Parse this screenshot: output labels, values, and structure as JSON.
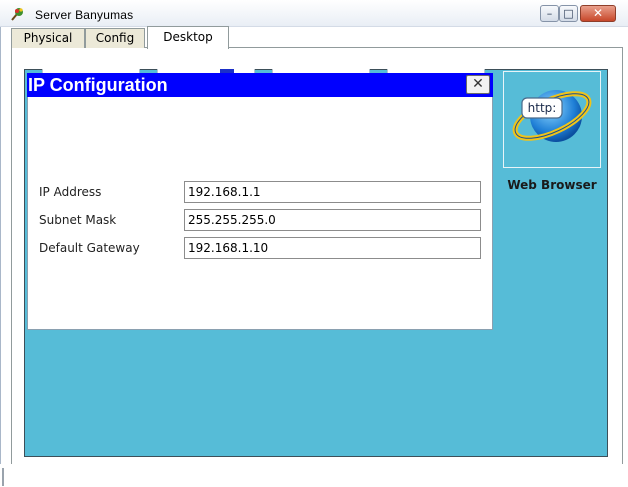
{
  "window": {
    "title": "Server  Banyumas",
    "minimize_glyph": "–",
    "maximize_glyph": "□",
    "close_glyph": "✕"
  },
  "tabs": [
    {
      "label": "Physical",
      "active": false
    },
    {
      "label": "Config",
      "active": false
    },
    {
      "label": "Desktop",
      "active": true
    }
  ],
  "desktop": {
    "background_color": "#56bcd7",
    "web_browser": {
      "icon": "web-browser-icon",
      "icon_text": "http:",
      "label": "Web Browser"
    }
  },
  "ip_configuration": {
    "title": "IP Configuration",
    "close_glyph": "✕",
    "title_bar_color": "#0000ff",
    "fields": {
      "ip_address": {
        "label": "IP Address",
        "value": "192.168.1.1"
      },
      "subnet_mask": {
        "label": "Subnet Mask",
        "value": "255.255.255.0"
      },
      "default_gateway": {
        "label": "Default Gateway",
        "value": "192.168.1.10"
      }
    }
  }
}
